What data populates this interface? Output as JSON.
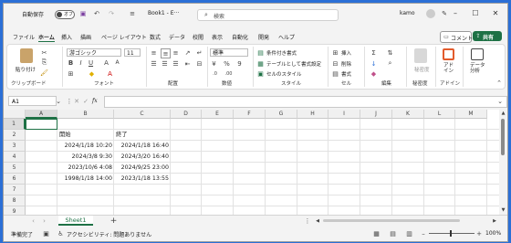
{
  "titlebar": {
    "autosave_label": "自動保存",
    "autosave_state": "オフ",
    "book_title": "Book1 - E···",
    "search_placeholder": "検索",
    "user_name": "kamo"
  },
  "menu": {
    "tabs": [
      "ファイル",
      "ホーム",
      "挿入",
      "描画",
      "ページ レイアウト",
      "数式",
      "データ",
      "校閲",
      "表示",
      "自動化",
      "開発",
      "ヘルプ"
    ],
    "active": "ホーム",
    "comment_label": "コメント",
    "share_label": "共有"
  },
  "ribbon": {
    "paste_label": "貼り付け",
    "clipboard_group": "クリップボード",
    "font_name": "游ゴシック",
    "font_size": "11",
    "font_group": "フォント",
    "align_group": "配置",
    "number_format": "標準",
    "number_group": "数値",
    "conditional_format": "条件付き書式",
    "format_as_table": "テーブルとして書式設定",
    "cell_styles": "セルのスタイル",
    "style_group": "スタイル",
    "insert_label": "挿入",
    "delete_label": "削除",
    "format_label": "書式",
    "cells_group": "セル",
    "edit_group": "編集",
    "sensitivity_label": "秘密度",
    "sensitivity_group": "秘密度",
    "addin_label": "アド\nイン",
    "addin_group": "アドイン",
    "data_analysis_label": "データ\n分析"
  },
  "formula": {
    "name_box": "A1",
    "fx": "fx",
    "value": ""
  },
  "sheet": {
    "columns": [
      "A",
      "B",
      "C",
      "D",
      "E",
      "F",
      "G",
      "H",
      "I",
      "J",
      "K",
      "L",
      "M"
    ],
    "rows": [
      "1",
      "2",
      "3",
      "4",
      "5",
      "6",
      "7",
      "8",
      "9"
    ],
    "cells": {
      "B2": "開始",
      "C2": "終了",
      "B3": "2024/1/18 10:20",
      "C3": "2024/1/18 16:40",
      "B4": "2024/3/8 9:30",
      "C4": "2024/3/20 16:40",
      "B5": "2023/10/6 4:08",
      "C5": "2024/9/25 23:00",
      "B6": "1998/1/18 14:00",
      "C6": "2023/1/18 13:55"
    }
  },
  "tabs": {
    "sheet_name": "Sheet1",
    "add": "+"
  },
  "status": {
    "ready": "準備完了",
    "accessibility": "アクセシビリティ: 問題ありません",
    "zoom": "100%"
  },
  "colors": {
    "accent": "#1e7145",
    "desktop": "#2b6fd6"
  }
}
